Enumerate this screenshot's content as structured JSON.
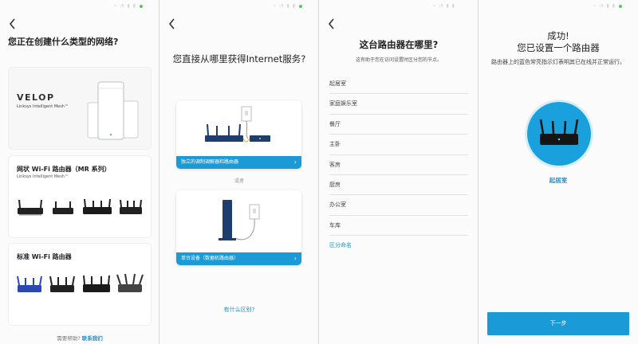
{
  "screen1": {
    "title": "您正在创建什么类型的网络?",
    "velop": {
      "logo": "VELOP",
      "subtitle": "Linksys Intelligent Mesh™"
    },
    "mesh": {
      "title": "网状 Wi-Fi 路由器（MR 系列）",
      "subtitle": "Linksys Intelligent Mesh™"
    },
    "standard": {
      "title": "标准 Wi-Fi 路由器"
    },
    "help_prefix": "需要帮助?",
    "help_link": "联系我们"
  },
  "screen2": {
    "title": "您直接从哪里获得Internet服务?",
    "option1_label": "独立的调制调解器和路由器",
    "or_text": "或者",
    "option2_label": "单台设备（数据机路由器）",
    "diff_link": "有什么区别?"
  },
  "screen3": {
    "title": "这台路由器在哪里?",
    "subtitle": "这有助于您在访问设置时区分您的节点。",
    "locations": [
      "起居室",
      "家庭娱乐室",
      "餐厅",
      "主卧",
      "客房",
      "厨房",
      "办公室",
      "车库"
    ],
    "custom_link": "区分命名"
  },
  "screen4": {
    "title_line1": "成功!",
    "title_line2": "您已设置一个路由器",
    "subtitle": "路由器上的蓝色常亮指示灯表明其已在线并正常运行。",
    "room": "起居室",
    "next_button": "下一步"
  },
  "colors": {
    "accent": "#1a9bd7",
    "link": "#1a8fd6",
    "status_dot": "#5fc25f"
  },
  "icons": [
    "back-chevron-icon",
    "chevron-right-icon",
    "router-icon",
    "velop-node-icon",
    "modem-icon",
    "power-outlet-icon"
  ]
}
